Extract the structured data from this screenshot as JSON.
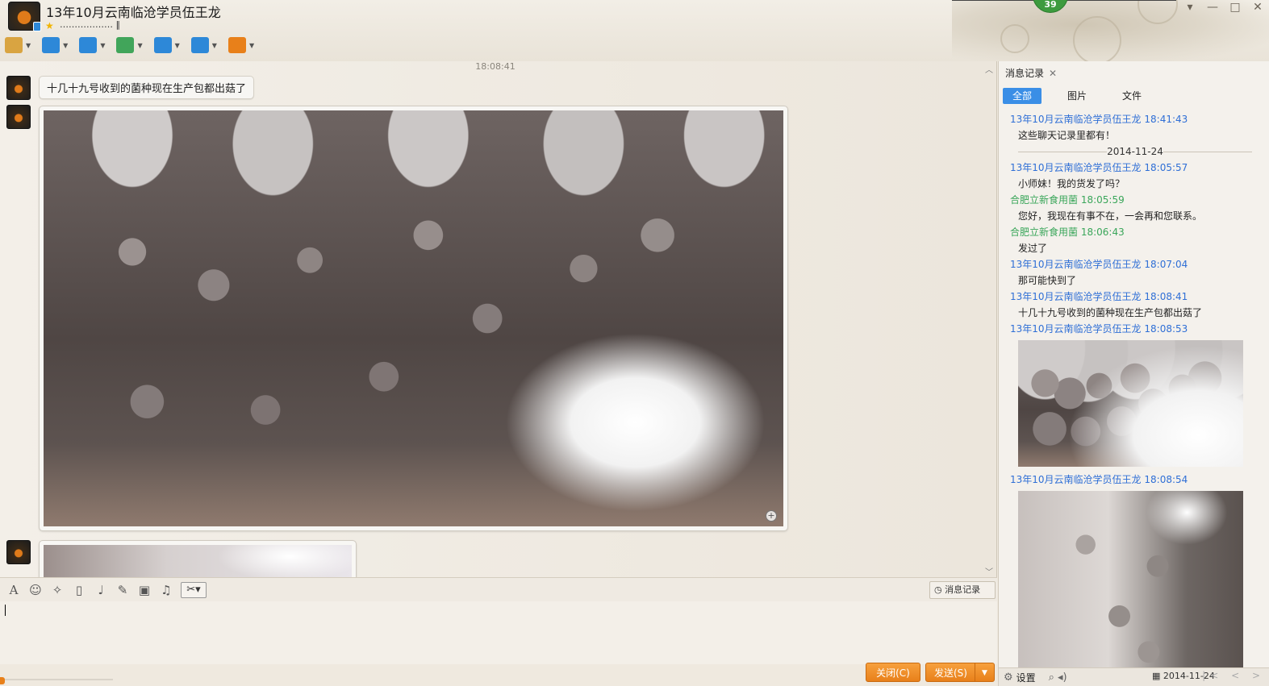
{
  "window": {
    "title": "13年10月云南临沧学员伍王龙",
    "signature": "……………… ‖",
    "level": "39",
    "controls": {
      "minimize": "▾",
      "min2": "—",
      "max": "□",
      "close": "✕"
    }
  },
  "toolbar": {
    "items": [
      {
        "icon": "microphone-icon",
        "color": "#d9a441"
      },
      {
        "icon": "camera-icon",
        "color": "#2d88d8"
      },
      {
        "icon": "file-transfer-icon",
        "color": "#2d88d8"
      },
      {
        "icon": "discussion-add-icon",
        "color": "#41a55a"
      },
      {
        "icon": "remote-desktop-icon",
        "color": "#2d88d8"
      },
      {
        "icon": "share-screen-icon",
        "color": "#2d88d8"
      },
      {
        "icon": "apps-grid-icon",
        "color": "#e8801a"
      }
    ]
  },
  "chat": {
    "time": "18:08:41",
    "messages": [
      {
        "type": "text",
        "text": "十几十九号收到的菌种现在生产包都出菇了"
      },
      {
        "type": "image"
      },
      {
        "type": "image"
      }
    ]
  },
  "input": {
    "history_label": "消息记录",
    "close_label": "关闭(C)",
    "send_label": "发送(S)"
  },
  "history": {
    "tab_label": "消息记录",
    "filters": [
      "全部",
      "图片",
      "文件"
    ],
    "entries": [
      {
        "kind": "head",
        "sender": "13年10月云南临沧学员伍王龙",
        "time": "18:41:43",
        "self": true
      },
      {
        "kind": "text",
        "text": "这些聊天记录里都有！"
      },
      {
        "kind": "date",
        "text": "2014-11-24"
      },
      {
        "kind": "head",
        "sender": "13年10月云南临沧学员伍王龙",
        "time": "18:05:57",
        "self": true
      },
      {
        "kind": "text",
        "text": "小师妹！我的货发了吗？"
      },
      {
        "kind": "head",
        "sender": "合肥立新食用菌",
        "time": "18:05:59",
        "self": false
      },
      {
        "kind": "text",
        "text": "您好，我现在有事不在，一会再和您联系。"
      },
      {
        "kind": "head",
        "sender": "合肥立新食用菌",
        "time": "18:06:43",
        "self": false
      },
      {
        "kind": "text",
        "text": "发过了"
      },
      {
        "kind": "head",
        "sender": "13年10月云南临沧学员伍王龙",
        "time": "18:07:04",
        "self": true
      },
      {
        "kind": "text",
        "text": "那可能快到了"
      },
      {
        "kind": "head",
        "sender": "13年10月云南临沧学员伍王龙",
        "time": "18:08:41",
        "self": true
      },
      {
        "kind": "text",
        "text": "十几十九号收到的菌种现在生产包都出菇了"
      },
      {
        "kind": "head",
        "sender": "13年10月云南临沧学员伍王龙",
        "time": "18:08:53",
        "self": true
      },
      {
        "kind": "image",
        "variant": "a"
      },
      {
        "kind": "head",
        "sender": "13年10月云南临沧学员伍王龙",
        "time": "18:08:54",
        "self": true
      },
      {
        "kind": "image",
        "variant": "b"
      }
    ],
    "settings_label": "设置",
    "date": "2014-11-24"
  }
}
